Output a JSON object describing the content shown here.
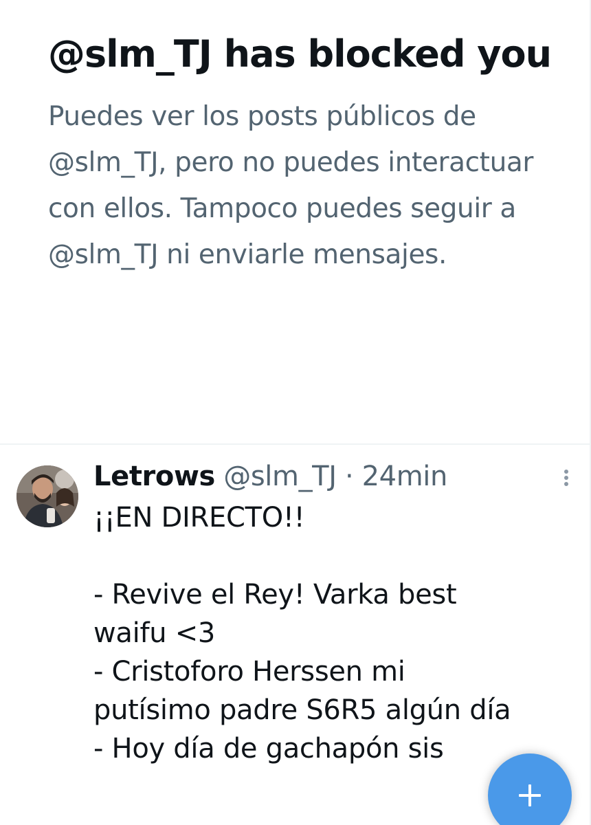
{
  "blocked_notice": {
    "title": "@slm_TJ has blocked you",
    "description": "Puedes ver los posts públicos de @slm_TJ, pero no puedes interactuar con ellos. Tampoco puedes seguir a @slm_TJ ni enviarle mensajes."
  },
  "tweet": {
    "avatar_icon": "profile-photo",
    "author_name": "Letrows",
    "author_handle": "@slm_TJ",
    "separator": "·",
    "time": "24min",
    "more_icon": "more-vertical-icon",
    "lines": [
      "¡¡EN DIRECTO!!",
      "",
      "- Revive el Rey! Varka best",
      "waifu <3",
      "- Cristoforo Herssen mi",
      "putísimo padre S6R5 algún día",
      "- Hoy día de gachapón sis"
    ]
  },
  "compose_button": {
    "icon": "plus-icon",
    "color": "#4a99e9"
  },
  "colors": {
    "primary_text": "#0f1419",
    "secondary_text": "#536471",
    "divider": "#eff3f4",
    "accent": "#4a99e9"
  }
}
